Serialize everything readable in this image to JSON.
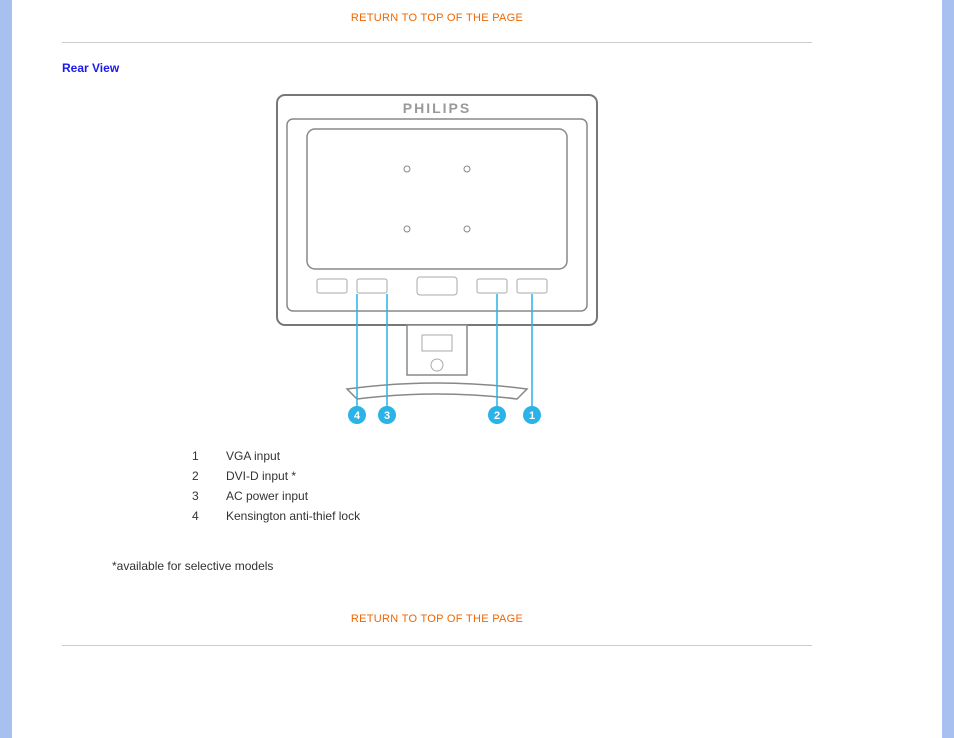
{
  "links": {
    "return_top": "RETURN TO TOP OF THE PAGE",
    "return_bottom": "RETURN TO TOP OF THE PAGE"
  },
  "section": {
    "title": "Rear View"
  },
  "brand": "PHILIPS",
  "callouts": [
    "4",
    "3",
    "2",
    "1"
  ],
  "legend": [
    {
      "num": "1",
      "label": "VGA input"
    },
    {
      "num": "2",
      "label": "DVI-D input *"
    },
    {
      "num": "3",
      "label": "AC power input"
    },
    {
      "num": "4",
      "label": "Kensington anti-thief lock"
    }
  ],
  "footnote": "*available for selective models"
}
